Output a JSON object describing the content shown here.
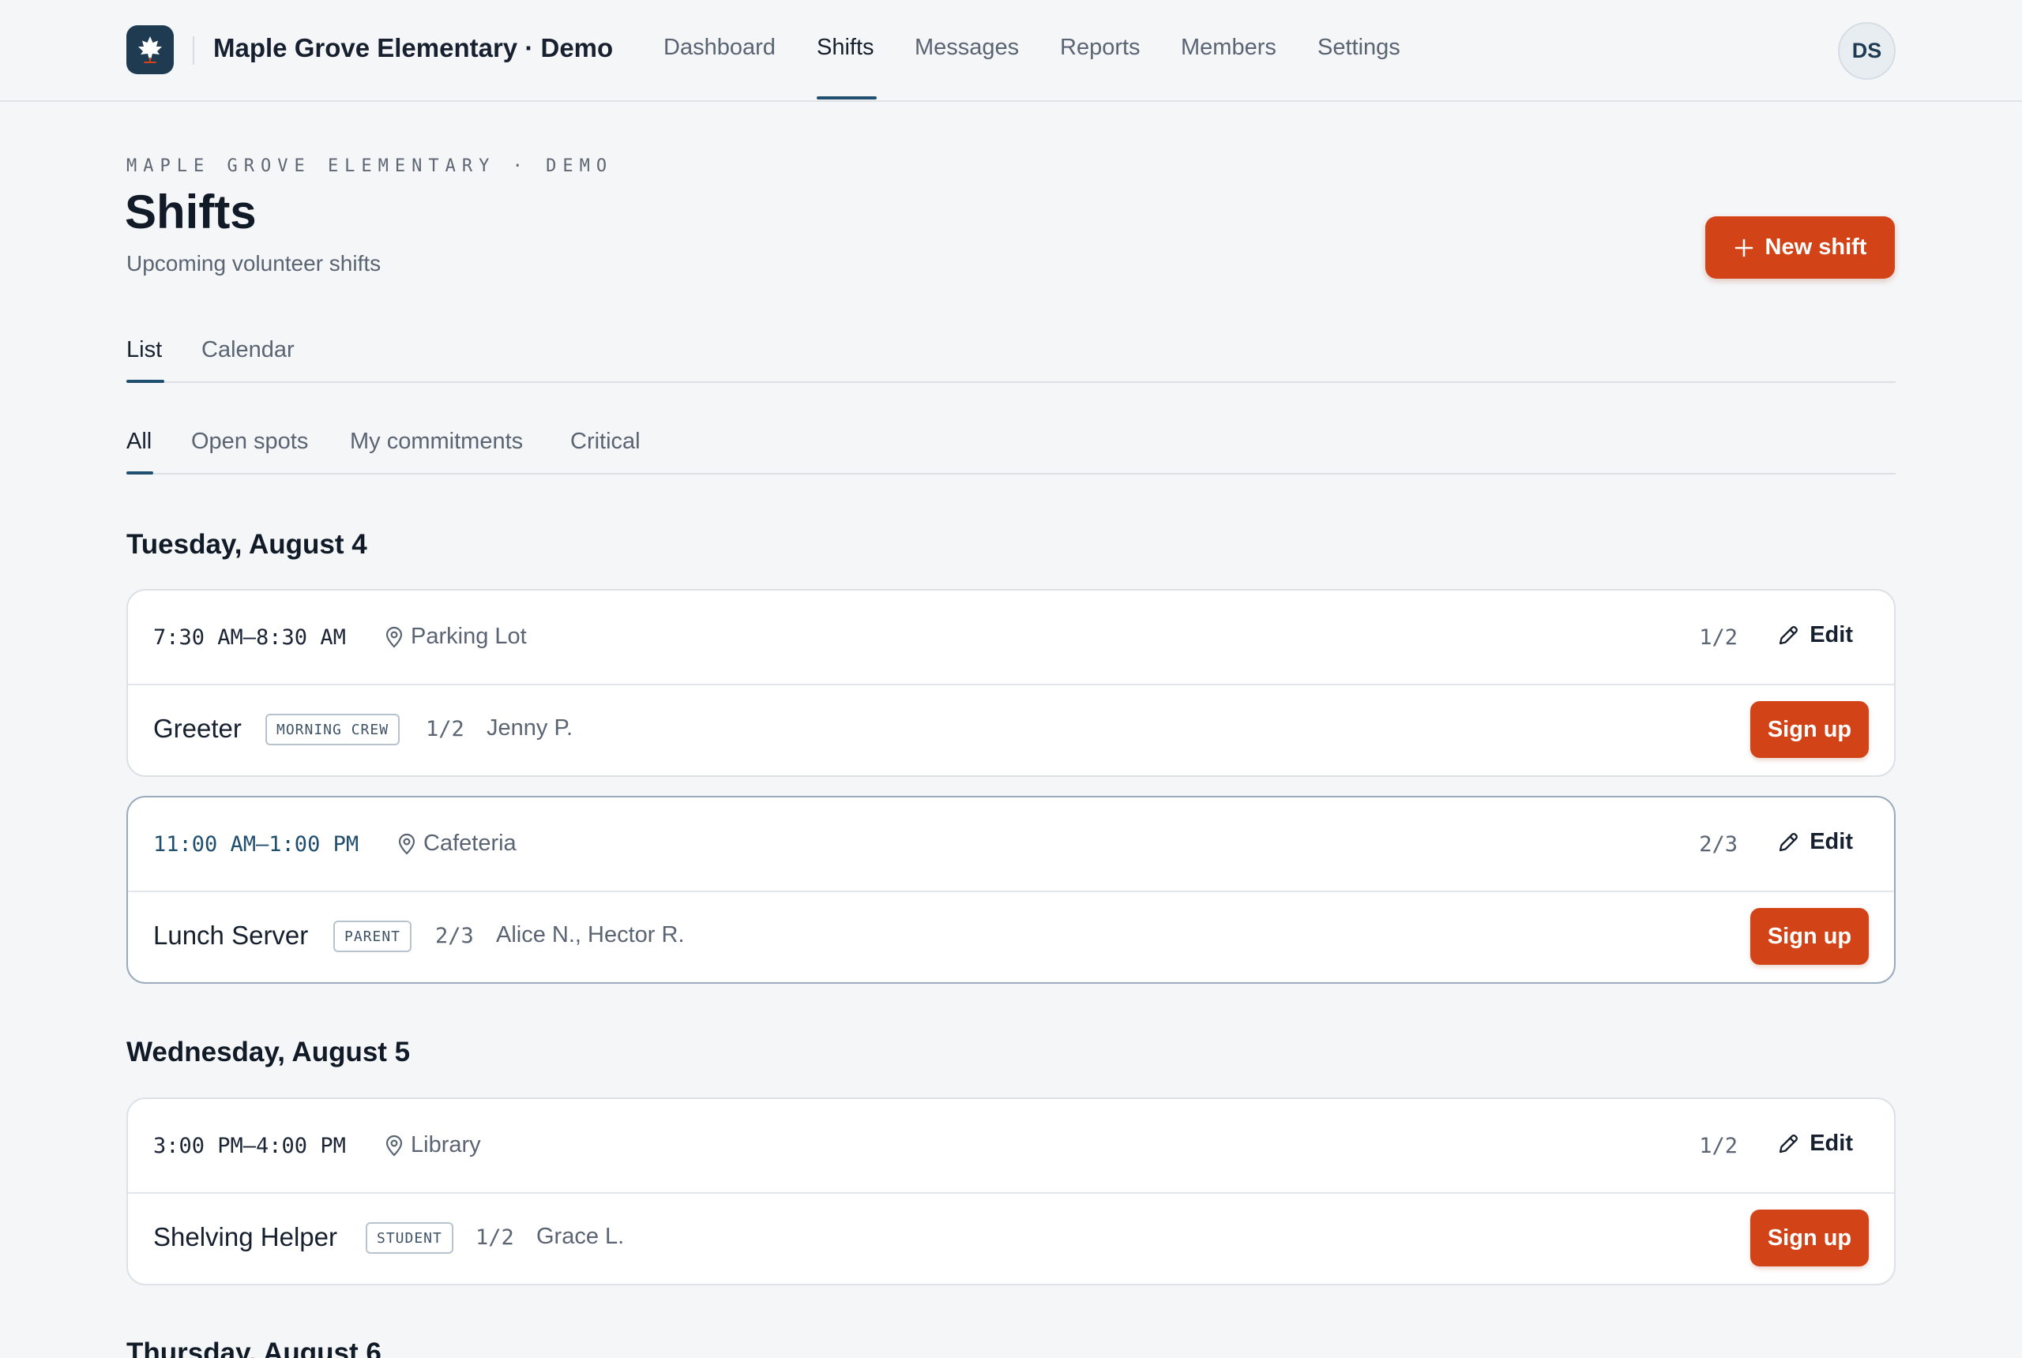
{
  "app": {
    "org": "Maple Grove Elementary · Demo",
    "avatar": "DS"
  },
  "nav": {
    "dashboard": "Dashboard",
    "shifts": "Shifts",
    "messages": "Messages",
    "reports": "Reports",
    "members": "Members",
    "settings": "Settings",
    "active": "Shifts"
  },
  "header": {
    "eyebrow": "MAPLE GROVE ELEMENTARY · DEMO",
    "title": "Shifts",
    "subtitle": "Upcoming volunteer shifts",
    "new_shift_label": "New shift"
  },
  "view_tabs": {
    "list": "List",
    "calendar": "Calendar",
    "active": "List"
  },
  "filter_tabs": {
    "all": "All",
    "open": "Open spots",
    "mine": "My commitments",
    "critical": "Critical",
    "active": "All"
  },
  "days": [
    {
      "heading": "Tuesday, August 4",
      "shifts": [
        {
          "time": "7:30 AM–8:30 AM",
          "location": "Parking Lot",
          "count": "1/2",
          "edit": "Edit",
          "role": "Greeter",
          "badge": "MORNING CREW",
          "role_count": "1/2",
          "names": "Jenny P.",
          "signup": "Sign up"
        },
        {
          "time": "11:00 AM–1:00 PM",
          "location": "Cafeteria",
          "count": "2/3",
          "edit": "Edit",
          "role": "Lunch Server",
          "badge": "PARENT",
          "role_count": "2/3",
          "names": "Alice N., Hector R.",
          "signup": "Sign up"
        }
      ]
    },
    {
      "heading": "Wednesday, August 5",
      "shifts": [
        {
          "time": "3:00 PM–4:00 PM",
          "location": "Library",
          "count": "1/2",
          "edit": "Edit",
          "role": "Shelving Helper",
          "badge": "STUDENT",
          "role_count": "1/2",
          "names": "Grace L.",
          "signup": "Sign up"
        }
      ]
    },
    {
      "heading": "Thursday, August 6"
    }
  ],
  "colors": {
    "accent": "#d24417",
    "brand": "#1f3b52",
    "active_underline": "#1f4e6e"
  }
}
